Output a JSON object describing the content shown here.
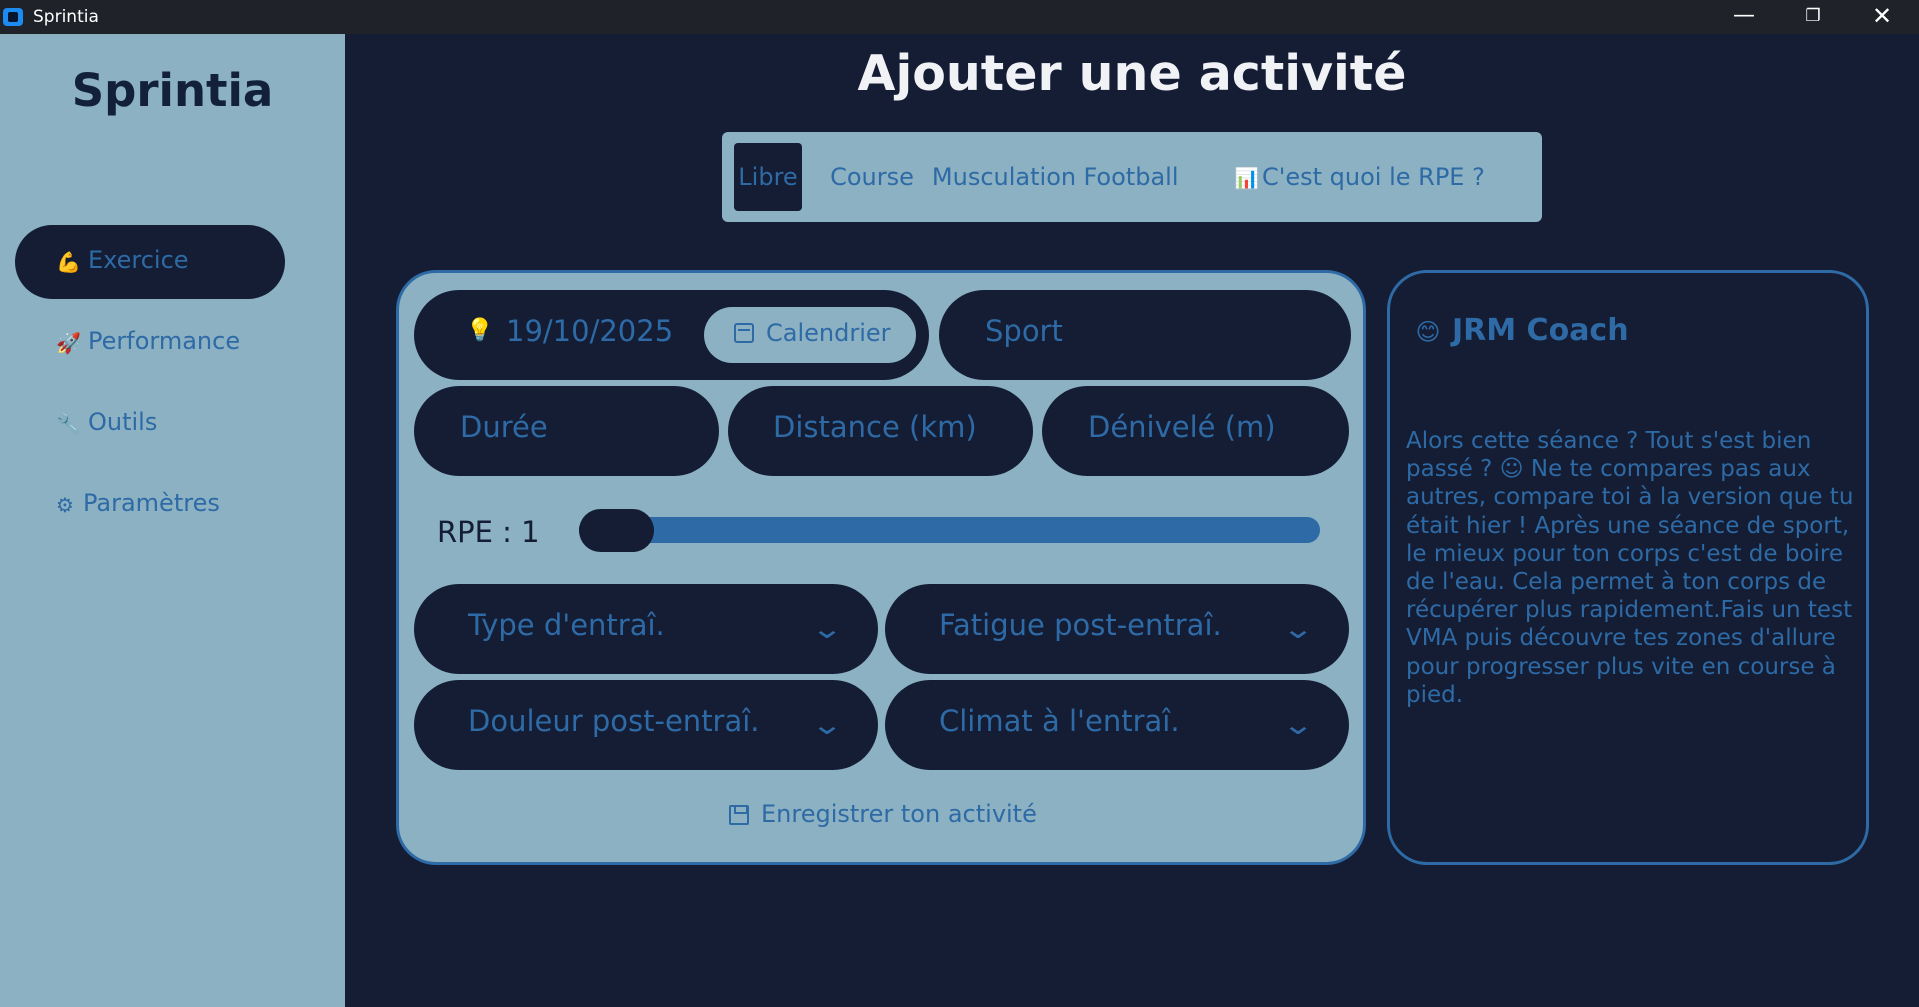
{
  "window": {
    "title": "Sprintia",
    "minimize_glyph": "—",
    "maximize_glyph": "❐",
    "close_glyph": "✕"
  },
  "sidebar": {
    "brand": "Sprintia",
    "items": [
      {
        "label": "Exercice",
        "icon": "bicep-icon",
        "glyph": "💪",
        "active": true
      },
      {
        "label": "Performance",
        "icon": "rocket-icon",
        "glyph": "🚀",
        "active": false
      },
      {
        "label": "Outils",
        "icon": "wrench-icon",
        "glyph": "🔧",
        "active": false
      },
      {
        "label": "Paramètres",
        "icon": "gear-icon",
        "glyph": "⚙",
        "active": false
      }
    ]
  },
  "main": {
    "title": "Ajouter une activité",
    "tabs": [
      {
        "label": "Libre",
        "active": true
      },
      {
        "label": "Course",
        "active": false
      },
      {
        "label": "Musculation",
        "active": false
      },
      {
        "label": "Football",
        "active": false
      }
    ],
    "rpe_help": {
      "label": "C'est quoi le RPE ?",
      "icon": "bar-chart-icon",
      "glyph": "📊"
    }
  },
  "form": {
    "date_icon": "lightbulb-icon",
    "date_glyph": "💡",
    "date": "19/10/2025",
    "calendar_label": "Calendrier",
    "sport_placeholder": "Sport",
    "duration_placeholder": "Durée",
    "distance_placeholder": "Distance (km)",
    "elevation_placeholder": "Dénivelé (m)",
    "rpe_label": "RPE : 1",
    "rpe_value": 1,
    "rpe_min": 1,
    "rpe_max": 10,
    "selects": [
      {
        "label": "Type d'entraî."
      },
      {
        "label": "Fatigue post-entraî."
      },
      {
        "label": "Douleur post-entraî."
      },
      {
        "label": "Climat à l'entraî."
      }
    ],
    "chevron_glyph": "⌄",
    "save_label": "Enregistrer ton activité"
  },
  "coach": {
    "title": "JRM Coach",
    "icon": "coach-face-icon",
    "glyph": "😊",
    "message": "Alors cette séance ? Tout s'est bien passé ? ☺ Ne te compares pas aux autres, compare toi à la version que tu était hier ! Après une séance de sport, le mieux pour ton corps c'est de boire de l'eau. Cela permet à ton corps de récupérer plus rapidement.Fais un test VMA puis découvre tes zones d'allure pour progresser plus vite en course à pied."
  },
  "colors": {
    "background": "#141d34",
    "panel": "#8bb1c2",
    "accent": "#2e6aa5",
    "text_dark": "#13203a"
  }
}
